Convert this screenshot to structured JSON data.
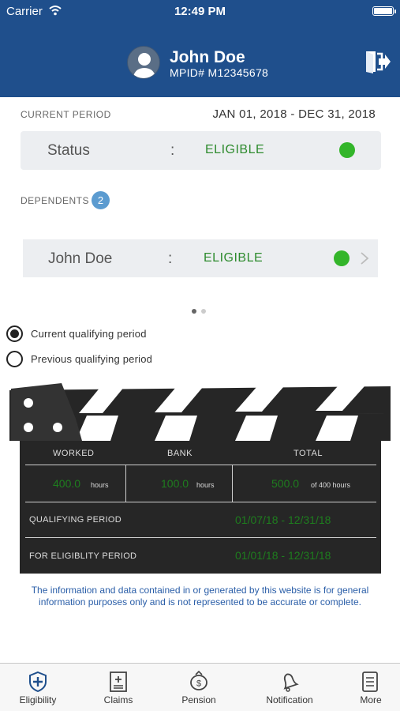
{
  "status_bar": {
    "carrier": "Carrier",
    "time": "12:49 PM"
  },
  "header": {
    "name": "John Doe",
    "mpid": "MPID# M12345678"
  },
  "current_period": {
    "label": "CURRENT PERIOD",
    "dates": "JAN 01, 2018 - DEC 31, 2018",
    "status_label": "Status",
    "separator": ":",
    "status_value": "ELIGIBLE",
    "status_color": "#33b52a"
  },
  "dependents": {
    "label": "DEPENDENTS",
    "count": "2",
    "items": [
      {
        "name": "John Doe",
        "separator": ":",
        "status": "ELIGIBLE",
        "status_color": "#33b52a"
      }
    ],
    "page_count": 2,
    "active_page": 0
  },
  "period_options": [
    {
      "label": "Current qualifying period",
      "selected": true
    },
    {
      "label": "Previous qualifying period",
      "selected": false
    }
  ],
  "hours_board": {
    "headers": {
      "worked": "WORKED",
      "bank": "BANK",
      "total": "TOTAL"
    },
    "worked": {
      "value": "400.0",
      "unit": "hours"
    },
    "bank": {
      "value": "100.0",
      "unit": "hours"
    },
    "total": {
      "value": "500.0",
      "unit": "of 400 hours"
    },
    "qualifying_label": "QUALIFYING PERIOD",
    "qualifying_value": "01/07/18 - 12/31/18",
    "eligibility_label": "FOR ELIGIBLITY PERIOD",
    "eligibility_value": "01/01/18 - 12/31/18"
  },
  "disclaimer": "The information and data contained in or generated by this website is for general information purposes only and is not represented to be accurate or complete.",
  "tabs": [
    {
      "label": "Eligibility",
      "icon": "shield-plus-icon",
      "active": true
    },
    {
      "label": "Claims",
      "icon": "document-plus-icon",
      "active": false
    },
    {
      "label": "Pension",
      "icon": "piggy-bank-icon",
      "active": false
    },
    {
      "label": "Notification",
      "icon": "bell-icon",
      "active": false
    },
    {
      "label": "More",
      "icon": "list-icon",
      "active": false
    }
  ],
  "colors": {
    "header": "#1f4f8c",
    "eligible_text": "#2e8b2e",
    "badge": "#5b9bd0",
    "disclaimer": "#2a5ea8"
  }
}
